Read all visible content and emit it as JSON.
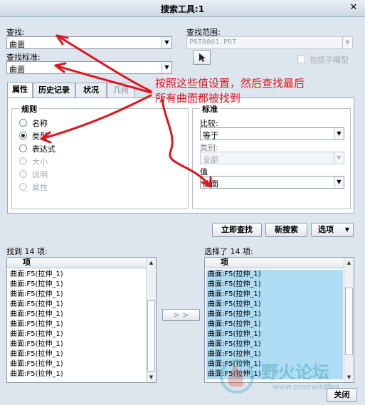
{
  "window": {
    "title": "搜索工具:1",
    "close_glyph": "✕"
  },
  "search": {
    "find_label": "查找:",
    "find_value": "曲面",
    "criteria_label": "查找标准:",
    "criteria_value": "曲面",
    "scope_label": "查找范围:",
    "scope_value": "PRT0001.PRT",
    "include_submodels_label": "包括子模型",
    "pick_icon": "arrow-cursor-icon"
  },
  "tabs": [
    {
      "label": "属性",
      "active": true
    },
    {
      "label": "历史记录",
      "active": false
    },
    {
      "label": "状况",
      "active": false
    },
    {
      "label": "几何",
      "active": false
    }
  ],
  "rules": {
    "title": "规则",
    "options": [
      {
        "label": "名称",
        "checked": false,
        "enabled": true
      },
      {
        "label": "类型",
        "checked": true,
        "enabled": true
      },
      {
        "label": "表达式",
        "checked": false,
        "enabled": true
      },
      {
        "label": "大小",
        "checked": false,
        "enabled": false
      },
      {
        "label": "说明",
        "checked": false,
        "enabled": false
      },
      {
        "label": "属性",
        "checked": false,
        "enabled": false
      }
    ]
  },
  "criteria": {
    "title": "标准",
    "compare_label": "比较:",
    "compare_value": "等于",
    "category_label": "类别:",
    "category_value": "全部",
    "value_label": "值",
    "value_value": "曲面"
  },
  "actions": {
    "find_now": "立即查找",
    "new_search": "新搜索",
    "options": "选项"
  },
  "found": {
    "label": "找到 14 项:",
    "header": "项",
    "items": [
      "曲面:F5(拉伸_1)",
      "曲面:F5(拉伸_1)",
      "曲面:F5(拉伸_1)",
      "曲面:F5(拉伸_1)",
      "曲面:F5(拉伸_1)",
      "曲面:F5(拉伸_1)",
      "曲面:F5(拉伸_1)",
      "曲面:F5(拉伸_1)",
      "曲面:F5(拉伸_1)",
      "曲面:F5(拉伸_1)",
      "曲面:F5(拉伸_1)"
    ]
  },
  "transfer_button": "> >",
  "selected": {
    "label": "选择了 14 项:",
    "header": "项",
    "items": [
      "曲面:F5(拉伸_1)",
      "曲面:F5(拉伸_1)",
      "曲面:F5(拉伸_1)",
      "曲面:F5(拉伸_1)",
      "曲面:F5(拉伸_1)",
      "曲面:F5(拉伸_1)",
      "曲面:F5(拉伸_1)",
      "曲面:F5(拉伸_1)",
      "曲面:F5(拉伸_1)",
      "曲面:F5(拉伸_1)",
      "曲面:F5(拉伸_1)"
    ]
  },
  "close_button": "关闭",
  "annotation": {
    "line1": "按照这些值设置，然后查找最后",
    "line2": "所有曲面都被找到",
    "color": "#e0141b"
  },
  "watermark": {
    "text": "野火论坛",
    "url": "www.proewildfire"
  }
}
